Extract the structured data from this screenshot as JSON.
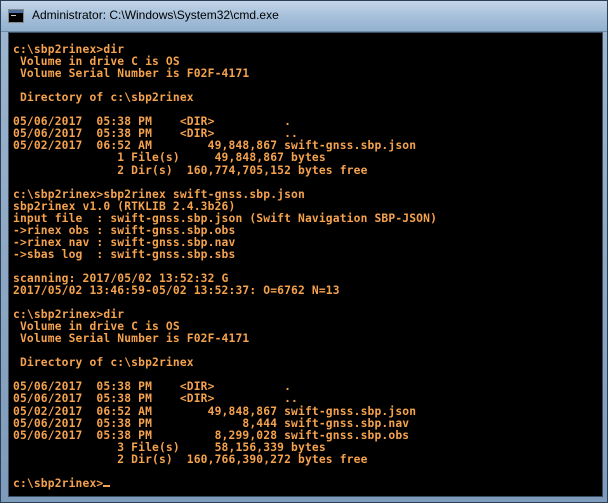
{
  "window": {
    "title": "Administrator: C:\\Windows\\System32\\cmd.exe",
    "icon": "cmd-icon"
  },
  "console": {
    "text_color": "#f5a24e",
    "background": "#000000",
    "lines": [
      "c:\\sbp2rinex>dir",
      " Volume in drive C is OS",
      " Volume Serial Number is F02F-4171",
      "",
      " Directory of c:\\sbp2rinex",
      "",
      "05/06/2017  05:38 PM    <DIR>          .",
      "05/06/2017  05:38 PM    <DIR>          ..",
      "05/02/2017  06:52 AM        49,848,867 swift-gnss.sbp.json",
      "               1 File(s)     49,848,867 bytes",
      "               2 Dir(s)  160,774,705,152 bytes free",
      "",
      "c:\\sbp2rinex>sbp2rinex swift-gnss.sbp.json",
      "sbp2rinex v1.0 (RTKLIB 2.4.3b26)",
      "input file  : swift-gnss.sbp.json (Swift Navigation SBP-JSON)",
      "->rinex obs : swift-gnss.sbp.obs",
      "->rinex nav : swift-gnss.sbp.nav",
      "->sbas log  : swift-gnss.sbp.sbs",
      "",
      "scanning: 2017/05/02 13:52:32 G",
      "2017/05/02 13:46:59-05/02 13:52:37: O=6762 N=13",
      "",
      "c:\\sbp2rinex>dir",
      " Volume in drive C is OS",
      " Volume Serial Number is F02F-4171",
      "",
      " Directory of c:\\sbp2rinex",
      "",
      "05/06/2017  05:38 PM    <DIR>          .",
      "05/06/2017  05:38 PM    <DIR>          ..",
      "05/02/2017  06:52 AM        49,848,867 swift-gnss.sbp.json",
      "05/06/2017  05:38 PM             8,444 swift-gnss.sbp.nav",
      "05/06/2017  05:38 PM         8,299,028 swift-gnss.sbp.obs",
      "               3 File(s)     58,156,339 bytes",
      "               2 Dir(s)  160,766,390,272 bytes free",
      "",
      "c:\\sbp2rinex>"
    ]
  }
}
